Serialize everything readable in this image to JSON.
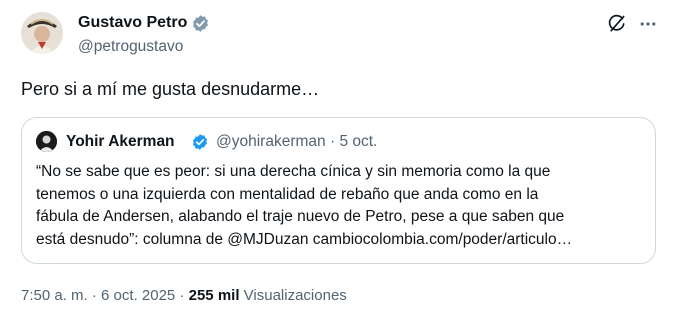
{
  "author": {
    "name": "Gustavo Petro",
    "handle": "@petrogustavo"
  },
  "tweet": {
    "text": "Pero si a mí me gusta desnudarme…"
  },
  "quoted": {
    "name": "Yohir Akerman",
    "handle": "@yohirakerman",
    "separator": "·",
    "date": "5 oct.",
    "lines": [
      "“No se sabe que es peor: si una derecha cínica y sin memoria como la que",
      "tenemos o una izquierda con mentalidad de rebaño que anda como en la",
      "fábula de Andersen, alabando el traje nuevo de Petro, pese a que saben que",
      "está desnudo”: columna de @MJDuzan cambiocolombia.com/poder/articulo…"
    ]
  },
  "footer": {
    "time": "7:50 a. m.",
    "separator": "·",
    "date": "6 oct. 2025",
    "separator2": "·",
    "views_count": "255 mil",
    "views_label": "Visualizaciones"
  },
  "icons": [
    "grok-icon",
    "more-icon",
    "verified-badge-icon"
  ],
  "colors": {
    "text": "#0f1419",
    "secondary": "#536471",
    "verified": "#1d9bf0",
    "border": "#cfd9de"
  }
}
